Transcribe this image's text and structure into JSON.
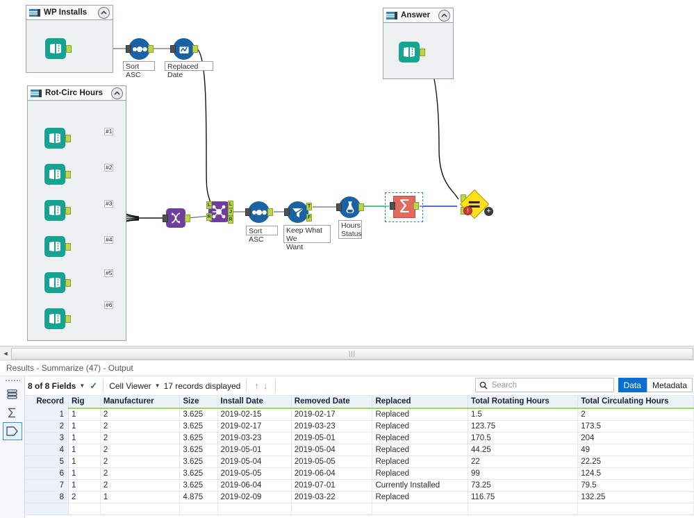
{
  "canvas": {
    "containers": [
      {
        "id": "wp-installs",
        "title": "WP Installs",
        "icon": "container-icon",
        "collapse_icon": "chevron-up-icon"
      },
      {
        "id": "answer",
        "title": "Answer",
        "icon": "container-icon",
        "collapse_icon": "chevron-up-icon"
      },
      {
        "id": "rot-circ-hours",
        "title": "Rot-Circ Hours",
        "icon": "container-icon",
        "collapse_icon": "chevron-up-icon"
      }
    ],
    "tool_labels": {
      "sort_asc_top": "Sort ASC",
      "replaced_date": "Replaced Date",
      "sort_asc_mid": "Sort ASC",
      "keep_what_we_want": "Keep What We\nWant",
      "hours_status": "Hours\nStatus"
    },
    "connection_labels": [
      "#1",
      "#2",
      "#3",
      "#4",
      "#5",
      "#6"
    ],
    "join_outputs": [
      "L",
      "J",
      "R"
    ],
    "join_inputs": [
      "L",
      "R"
    ],
    "filter_outputs": [
      "T",
      "F"
    ],
    "error_badge": "!",
    "plus_badge": "+",
    "sigma_glyph": "Σ",
    "colors": {
      "input_tool": "#17a391",
      "blue_tool": "#1b62a5",
      "purple_tool": "#6e3f9e",
      "summarize_tool": "#e1695d",
      "test_tool": "#ffe01b",
      "connector_nub": "#bcd64b",
      "selection": "#2f84e0",
      "container_fill": "#eef1f1"
    }
  },
  "splitter": {
    "left_arrow": "collapse-left-icon",
    "grip": "|||"
  },
  "results": {
    "title": "Results - Summarize (47) - Output",
    "sidebar": [
      {
        "name": "table-view-icon",
        "active": false
      },
      {
        "name": "summarize-icon",
        "active": false
      },
      {
        "name": "output-tag-icon",
        "active": true
      }
    ],
    "toolbar": {
      "fields_label": "8 of 8 Fields",
      "fields_caret": "caret-down-icon",
      "fields_check": "✓",
      "viewer_label": "Cell Viewer",
      "viewer_caret": "caret-down-icon",
      "records_label": "17 records displayed",
      "arrow_up": "↑",
      "arrow_down": "↓"
    },
    "search": {
      "placeholder": "Search",
      "value": "",
      "icon": "search-icon"
    },
    "view_toggle": {
      "data_label": "Data",
      "metadata_label": "Metadata",
      "selected": "Data"
    },
    "table": {
      "columns": [
        "Record",
        "Rig",
        "Manufacturer",
        "Size",
        "Install Date",
        "Removed Date",
        "Replaced",
        "Total Rotating Hours",
        "Total Circulating Hours"
      ],
      "rows": [
        [
          "1",
          "1",
          "2",
          "3.625",
          "2019-02-15",
          "2019-02-17",
          "Replaced",
          "1.5",
          "2"
        ],
        [
          "2",
          "1",
          "2",
          "3.625",
          "2019-02-17",
          "2019-03-23",
          "Replaced",
          "123.75",
          "173.5"
        ],
        [
          "3",
          "1",
          "2",
          "3.625",
          "2019-03-23",
          "2019-05-01",
          "Replaced",
          "170.5",
          "204"
        ],
        [
          "4",
          "1",
          "2",
          "3.625",
          "2019-05-01",
          "2019-05-04",
          "Replaced",
          "44.25",
          "49"
        ],
        [
          "5",
          "1",
          "2",
          "3.625",
          "2019-05-04",
          "2019-05-05",
          "Replaced",
          "22",
          "22.25"
        ],
        [
          "6",
          "1",
          "2",
          "3.625",
          "2019-05-05",
          "2019-06-04",
          "Replaced",
          "99",
          "124.5"
        ],
        [
          "7",
          "1",
          "2",
          "3.625",
          "2019-06-04",
          "2019-07-01",
          "Currently Installed",
          "73.25",
          "79.5"
        ],
        [
          "8",
          "2",
          "1",
          "4.875",
          "2019-02-09",
          "2019-03-22",
          "Replaced",
          "116.75",
          "132.25"
        ]
      ]
    }
  }
}
